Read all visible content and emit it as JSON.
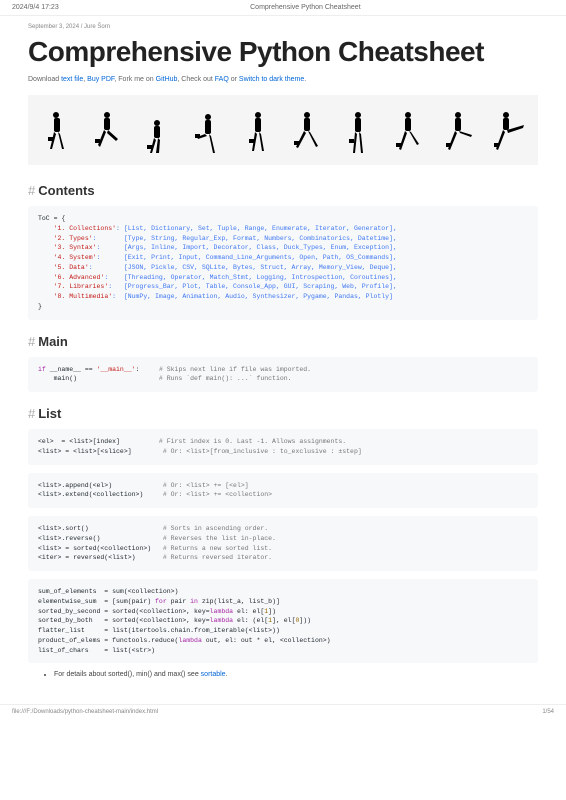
{
  "browser": {
    "datetime": "2024/9/4 17:23",
    "tab_title": "Comprehensive Python Cheatsheet"
  },
  "meta_line": "September 3, 2024 / Jure Šorn",
  "title": "Comprehensive Python Cheatsheet",
  "subtitle": {
    "t1": "Download ",
    "l1": "text file",
    "t2": ", ",
    "l2": "Buy PDF",
    "t3": ", Fork me on ",
    "l3": "GitHub",
    "t4": ", Check out ",
    "l4": "FAQ",
    "t5": " or ",
    "l5": "Switch to dark theme",
    "t6": "."
  },
  "sections": {
    "contents": "Contents",
    "main": "Main",
    "list": "List"
  },
  "toc": {
    "open": "ToC = {",
    "rows": [
      {
        "k": "'1. Collections'",
        "v": ": [List, Dictionary, Set, Tuple, Range, Enumerate, Iterator, Generator],"
      },
      {
        "k": "'2. Types'",
        "v": ":       [Type, String, Regular_Exp, Format, Numbers, Combinatorics, Datetime],"
      },
      {
        "k": "'3. Syntax'",
        "v": ":      [Args, Inline, Import, Decorator, Class, Duck_Types, Enum, Exception],"
      },
      {
        "k": "'4. System'",
        "v": ":      [Exit, Print, Input, Command_Line_Arguments, Open, Path, OS_Commands],"
      },
      {
        "k": "'5. Data'",
        "v": ":        [JSON, Pickle, CSV, SQLite, Bytes, Struct, Array, Memory_View, Deque],"
      },
      {
        "k": "'6. Advanced'",
        "v": ":    [Threading, Operator, Match_Stmt, Logging, Introspection, Coroutines],"
      },
      {
        "k": "'7. Libraries'",
        "v": ":   [Progress_Bar, Plot, Table, Console_App, GUI, Scraping, Web, Profile],"
      },
      {
        "k": "'8. Multimedia'",
        "v": ":  [NumPy, Image, Animation, Audio, Synthesizer, Pygame, Pandas, Plotly]"
      }
    ],
    "close": "}"
  },
  "main_block": {
    "l1a": "if",
    "l1b": " __name__ == ",
    "l1c": "'__main__'",
    "l1d": ":     ",
    "l1cmt": "# Skips next line if file was imported.",
    "l2a": "    main()                     ",
    "l2cmt": "# Runs `def main(): ...` function."
  },
  "list_blocks": {
    "b1": {
      "l1": "<el>  = <list>[index]          ",
      "c1": "# First index is 0. Last -1. Allows assignments.",
      "l2": "<list> = <list>[<slice>]        ",
      "c2": "# Or: <list>[from_inclusive : to_exclusive : ±step]"
    },
    "b2": {
      "l1": "<list>.append(<el>)             ",
      "c1": "# Or: <list> += [<el>]",
      "l2": "<list>.extend(<collection>)     ",
      "c2": "# Or: <list> += <collection>"
    },
    "b3": {
      "l1": "<list>.sort()                   ",
      "c1": "# Sorts in ascending order.",
      "l2": "<list>.reverse()                ",
      "c2": "# Reverses the list in-place.",
      "l3": "<list> = sorted(<collection>)   ",
      "c3": "# Returns a new sorted list.",
      "l4": "<iter> = reversed(<list>)       ",
      "c4": "# Returns reversed iterator."
    },
    "b4": {
      "l1": "sum_of_elements  = sum(<collection>)",
      "l2a": "elementwise_sum  = [sum(pair) ",
      "l2k": "for",
      "l2b": " pair ",
      "l2k2": "in",
      "l2c": " zip(list_a, list_b)]",
      "l3a": "sorted_by_second = sorted(<collection>, key=",
      "l3k": "lambda",
      "l3b": " el: el[",
      "l3n": "1",
      "l3c": "])",
      "l4a": "sorted_by_both   = sorted(<collection>, key=",
      "l4k": "lambda",
      "l4b": " el: (el[",
      "l4n1": "1",
      "l4c": "], el[",
      "l4n2": "0",
      "l4d": "]))",
      "l5": "flatter_list     = list(itertools.chain.from_iterable(<list>))",
      "l6a": "product_of_elems = functools.reduce(",
      "l6k": "lambda",
      "l6b": " out, el: out * el, <collection>)",
      "l7": "list_of_chars    = list(<str>)"
    }
  },
  "note": {
    "text": "For details about sorted(), min() and max() see ",
    "link": "sortable",
    "suffix": "."
  },
  "footer": {
    "path": "file:///F:/Downloads/python-cheatsheet-main/index.html",
    "page": "1/54"
  }
}
